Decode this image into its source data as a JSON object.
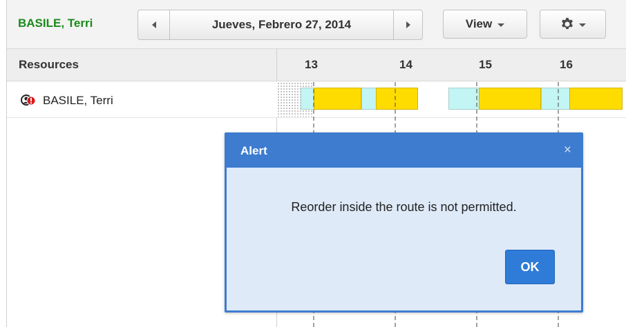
{
  "toolbar": {
    "user_name": "BASILE, Terri",
    "date_label": "Jueves, Febrero 27, 2014",
    "view_label": "View"
  },
  "header": {
    "resources_label": "Resources",
    "ticks": [
      "13",
      "14",
      "15",
      "16"
    ]
  },
  "resources": [
    {
      "name": "BASILE, Terri"
    }
  ],
  "dialog": {
    "title": "Alert",
    "close_symbol": "×",
    "message": "Reorder inside the route is not permitted.",
    "ok_label": "OK"
  },
  "icons": {
    "prev": "chevron-left-icon",
    "next": "chevron-right-icon",
    "view_caret": "caret-down-icon",
    "settings": "gear-icon",
    "resource_status": "alert-person-icon"
  },
  "colors": {
    "user_name": "#1a8a1a",
    "dialog_header": "#3d7ccf",
    "dialog_body": "#deeaf8",
    "ok_button": "#2f7bd8",
    "segment_yellow": "#ffdc00",
    "segment_cyan": "#c2f5f3"
  }
}
